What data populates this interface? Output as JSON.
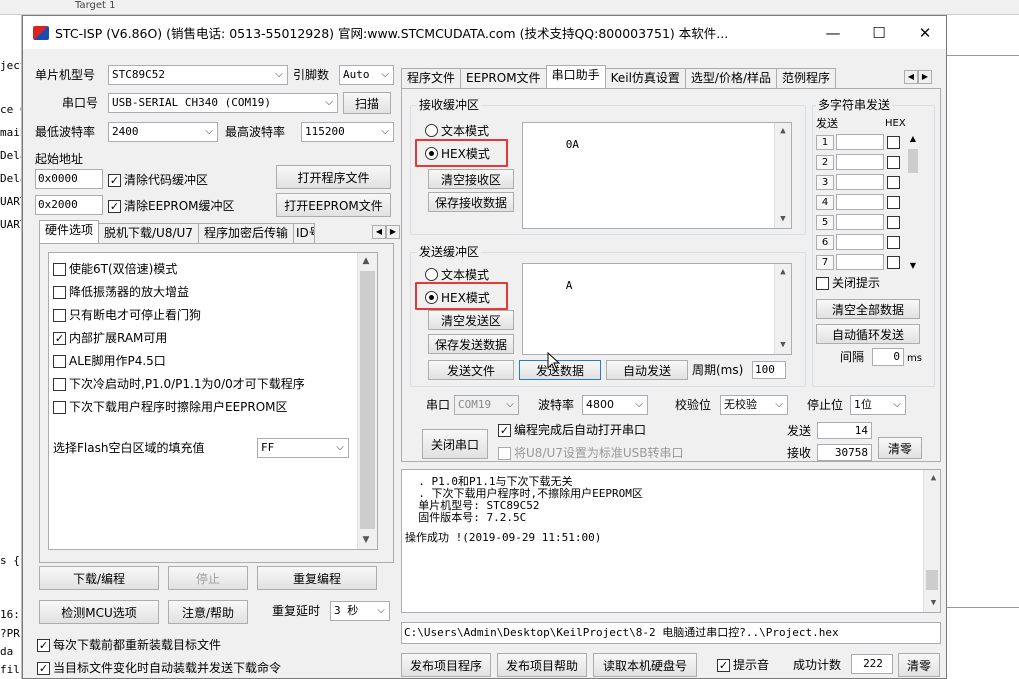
{
  "background": {
    "toolbar_text": "Target 1",
    "left_lines": [
      "ject",
      "",
      "ce C",
      "main",
      "Dela",
      "Dela",
      "UART",
      "UART"
    ],
    "left_lower": [
      "s {",
      "",
      "16:",
      "?PR",
      " da",
      "fil"
    ]
  },
  "window": {
    "title": "STC-ISP (V6.86O) (销售电话: 0513-55012928) 官网:www.STCMCUDATA.com  (技术支持QQ:800003751) 本软件...",
    "minimize": "—",
    "maximize": "☐",
    "close": "✕"
  },
  "left": {
    "mcu_label": "单片机型号",
    "mcu_value": "STC89C52",
    "pins_label": "引脚数",
    "pins_value": "Auto",
    "port_label": "串口号",
    "port_value": "USB-SERIAL CH340 (COM19)",
    "scan_button": "扫描",
    "min_baud_label": "最低波特率",
    "min_baud_value": "2400",
    "max_baud_label": "最高波特率",
    "max_baud_value": "115200",
    "start_addr_label": "起始地址",
    "addr1": "0x0000",
    "clear_code_label": "清除代码缓冲区",
    "open_prog_button": "打开程序文件",
    "addr2": "0x2000",
    "clear_eeprom_label": "清除EEPROM缓冲区",
    "open_eeprom_button": "打开EEPROM文件",
    "tabs": [
      "硬件选项",
      "脱机下载/U8/U7",
      "程序加密后传输",
      "ID号"
    ],
    "options": [
      {
        "label": "使能6T(双倍速)模式",
        "checked": false
      },
      {
        "label": "降低振荡器的放大增益",
        "checked": false
      },
      {
        "label": "只有断电才可停止看门狗",
        "checked": false
      },
      {
        "label": "内部扩展RAM可用",
        "checked": true
      },
      {
        "label": "ALE脚用作P4.5口",
        "checked": false
      },
      {
        "label": "下次冷启动时,P1.0/P1.1为0/0才可下载程序",
        "checked": false
      },
      {
        "label": "下次下载用户程序时擦除用户EEPROM区",
        "checked": false
      }
    ],
    "flash_fill_label": "选择Flash空白区域的填充值",
    "flash_fill_value": "FF",
    "download_button": "下载/编程",
    "stop_button": "停止",
    "reprogram_button": "重复编程",
    "detect_button": "检测MCU选项",
    "help_button": "注意/帮助",
    "repeat_delay_label": "重复延时",
    "repeat_delay_value": "3 秒",
    "reload_label": "每次下载前都重新装载目标文件",
    "auto_load_label": "当目标文件变化时自动装载并发送下载命令"
  },
  "right": {
    "tabs": [
      "程序文件",
      "EEPROM文件",
      "串口助手",
      "Keil仿真设置",
      "选型/价格/样品",
      "范例程序"
    ],
    "active_tab": "串口助手",
    "recv_group": "接收缓冲区",
    "recv_text_mode": "文本模式",
    "recv_hex_mode": "HEX模式",
    "recv_clear": "清空接收区",
    "recv_save": "保存接收数据",
    "recv_data": "0A",
    "send_group": "发送缓冲区",
    "send_text_mode": "文本模式",
    "send_hex_mode": "HEX模式",
    "send_clear": "清空发送区",
    "send_save": "保存发送数据",
    "send_data": "A",
    "send_file": "发送文件",
    "send_data_button": "发送数据",
    "auto_send": "自动发送",
    "period_label": "周期(ms)",
    "period_value": "100",
    "multi_group": "多字符串发送",
    "multi_send_header": "发送",
    "multi_hex_header": "HEX",
    "multi_rows": [
      "1",
      "2",
      "3",
      "4",
      "5",
      "6",
      "7"
    ],
    "close_tip": "关闭提示",
    "clear_all": "清空全部数据",
    "auto_loop": "自动循环发送",
    "interval_label": "间隔",
    "interval_value": "0",
    "interval_unit": "ms",
    "port_label": "串口",
    "port_value": "COM19",
    "baud_label": "波特率",
    "baud_value": "4800",
    "parity_label": "校验位",
    "parity_value": "无校验",
    "stop_label": "停止位",
    "stop_value": "1位",
    "close_port": "关闭串口",
    "auto_open": "编程完成后自动打开串口",
    "u8_std": "将U8/U7设置为标准USB转串口",
    "sent_label": "发送",
    "sent_value": "14",
    "recv_label": "接收",
    "recv_value": "30758",
    "clear_count": "清零",
    "log_lines": [
      "  . P1.0和P1.1与下次下载无关",
      "  . 下次下载用户程序时,不擦除用户EEPROM区",
      "",
      "  单片机型号: STC89C52",
      "  固件版本号: 7.2.5C",
      "",
      "",
      "操作成功 !(2019-09-29 11:51:00)"
    ],
    "path": "C:\\Users\\Admin\\Desktop\\KeilProject\\8-2 电脑通过串口控?..\\Project.hex",
    "publish_button": "发布项目程序",
    "publish_help": "发布项目帮助",
    "read_disk": "读取本机硬盘号",
    "beep_label": "提示音",
    "success_label": "成功计数",
    "success_value": "222",
    "clear_success": "清零"
  }
}
